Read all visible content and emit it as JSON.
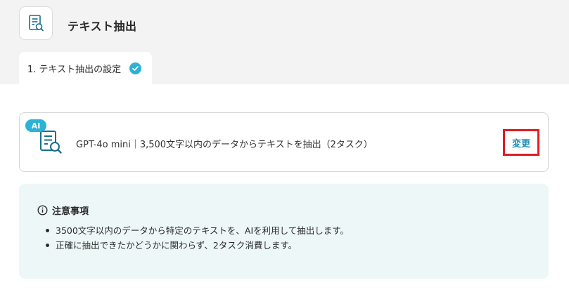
{
  "header": {
    "title": "テキスト抽出",
    "icon": "document-search-icon"
  },
  "tabs": [
    {
      "label": "1. テキスト抽出の設定",
      "status": "complete",
      "icon": "check-circle-icon"
    }
  ],
  "action_card": {
    "badge": "AI",
    "icon": "document-search-icon",
    "description": "GPT-4o mini｜3,500文字以内のデータからテキストを抽出（2タスク）",
    "change_label": "変更"
  },
  "notice": {
    "heading": "注意事項",
    "icon": "info-icon",
    "items": [
      "3500文字以内のデータから特定のテキストを、AIを利用して抽出します。",
      "正確に抽出できたかどうかに関わらず、2タスク消費します。"
    ]
  },
  "colors": {
    "accent": "#2bb2d6",
    "link": "#1d8fb8",
    "highlight_border": "#e01b24",
    "notice_background": "#eef7f7",
    "top_background": "#f3f3f3"
  }
}
